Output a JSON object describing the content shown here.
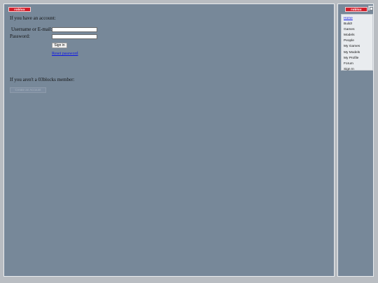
{
  "logo_text": "roblox",
  "login": {
    "heading": "If you have an account:",
    "username_label": "Username or E-mail:",
    "password_label": "Password:",
    "signin_label": "Sign in",
    "reset_label": "Reset password"
  },
  "signup": {
    "heading": "If you aren't a 03blocks member:",
    "create_label": "Create an Account"
  },
  "nav": {
    "items": [
      {
        "label": "Home"
      },
      {
        "label": "Build!"
      },
      {
        "label": "Games"
      },
      {
        "label": "Models"
      },
      {
        "label": "People"
      },
      {
        "label": "My Games"
      },
      {
        "label": "My Models"
      },
      {
        "label": "My Profile"
      },
      {
        "label": "Forum"
      },
      {
        "label": "Sign In"
      }
    ]
  }
}
